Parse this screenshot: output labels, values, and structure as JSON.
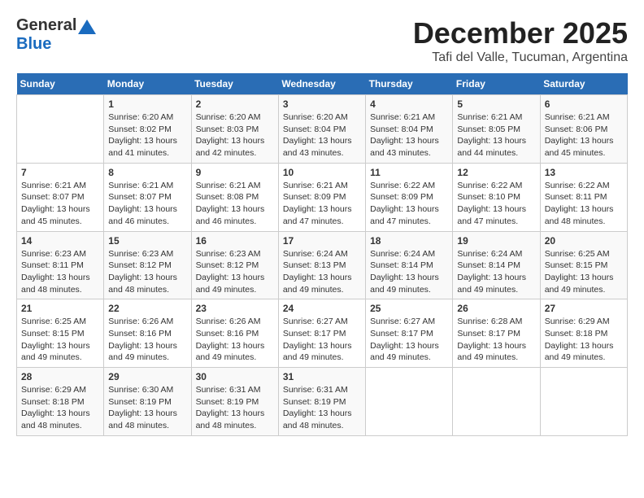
{
  "logo": {
    "general": "General",
    "blue": "Blue"
  },
  "title": "December 2025",
  "subtitle": "Tafi del Valle, Tucuman, Argentina",
  "weekdays": [
    "Sunday",
    "Monday",
    "Tuesday",
    "Wednesday",
    "Thursday",
    "Friday",
    "Saturday"
  ],
  "weeks": [
    [
      {
        "day": "",
        "content": ""
      },
      {
        "day": "1",
        "content": "Sunrise: 6:20 AM\nSunset: 8:02 PM\nDaylight: 13 hours and 41 minutes."
      },
      {
        "day": "2",
        "content": "Sunrise: 6:20 AM\nSunset: 8:03 PM\nDaylight: 13 hours and 42 minutes."
      },
      {
        "day": "3",
        "content": "Sunrise: 6:20 AM\nSunset: 8:04 PM\nDaylight: 13 hours and 43 minutes."
      },
      {
        "day": "4",
        "content": "Sunrise: 6:21 AM\nSunset: 8:04 PM\nDaylight: 13 hours and 43 minutes."
      },
      {
        "day": "5",
        "content": "Sunrise: 6:21 AM\nSunset: 8:05 PM\nDaylight: 13 hours and 44 minutes."
      },
      {
        "day": "6",
        "content": "Sunrise: 6:21 AM\nSunset: 8:06 PM\nDaylight: 13 hours and 45 minutes."
      }
    ],
    [
      {
        "day": "7",
        "content": "Sunrise: 6:21 AM\nSunset: 8:07 PM\nDaylight: 13 hours and 45 minutes."
      },
      {
        "day": "8",
        "content": "Sunrise: 6:21 AM\nSunset: 8:07 PM\nDaylight: 13 hours and 46 minutes."
      },
      {
        "day": "9",
        "content": "Sunrise: 6:21 AM\nSunset: 8:08 PM\nDaylight: 13 hours and 46 minutes."
      },
      {
        "day": "10",
        "content": "Sunrise: 6:21 AM\nSunset: 8:09 PM\nDaylight: 13 hours and 47 minutes."
      },
      {
        "day": "11",
        "content": "Sunrise: 6:22 AM\nSunset: 8:09 PM\nDaylight: 13 hours and 47 minutes."
      },
      {
        "day": "12",
        "content": "Sunrise: 6:22 AM\nSunset: 8:10 PM\nDaylight: 13 hours and 47 minutes."
      },
      {
        "day": "13",
        "content": "Sunrise: 6:22 AM\nSunset: 8:11 PM\nDaylight: 13 hours and 48 minutes."
      }
    ],
    [
      {
        "day": "14",
        "content": "Sunrise: 6:23 AM\nSunset: 8:11 PM\nDaylight: 13 hours and 48 minutes."
      },
      {
        "day": "15",
        "content": "Sunrise: 6:23 AM\nSunset: 8:12 PM\nDaylight: 13 hours and 48 minutes."
      },
      {
        "day": "16",
        "content": "Sunrise: 6:23 AM\nSunset: 8:12 PM\nDaylight: 13 hours and 49 minutes."
      },
      {
        "day": "17",
        "content": "Sunrise: 6:24 AM\nSunset: 8:13 PM\nDaylight: 13 hours and 49 minutes."
      },
      {
        "day": "18",
        "content": "Sunrise: 6:24 AM\nSunset: 8:14 PM\nDaylight: 13 hours and 49 minutes."
      },
      {
        "day": "19",
        "content": "Sunrise: 6:24 AM\nSunset: 8:14 PM\nDaylight: 13 hours and 49 minutes."
      },
      {
        "day": "20",
        "content": "Sunrise: 6:25 AM\nSunset: 8:15 PM\nDaylight: 13 hours and 49 minutes."
      }
    ],
    [
      {
        "day": "21",
        "content": "Sunrise: 6:25 AM\nSunset: 8:15 PM\nDaylight: 13 hours and 49 minutes."
      },
      {
        "day": "22",
        "content": "Sunrise: 6:26 AM\nSunset: 8:16 PM\nDaylight: 13 hours and 49 minutes."
      },
      {
        "day": "23",
        "content": "Sunrise: 6:26 AM\nSunset: 8:16 PM\nDaylight: 13 hours and 49 minutes."
      },
      {
        "day": "24",
        "content": "Sunrise: 6:27 AM\nSunset: 8:17 PM\nDaylight: 13 hours and 49 minutes."
      },
      {
        "day": "25",
        "content": "Sunrise: 6:27 AM\nSunset: 8:17 PM\nDaylight: 13 hours and 49 minutes."
      },
      {
        "day": "26",
        "content": "Sunrise: 6:28 AM\nSunset: 8:17 PM\nDaylight: 13 hours and 49 minutes."
      },
      {
        "day": "27",
        "content": "Sunrise: 6:29 AM\nSunset: 8:18 PM\nDaylight: 13 hours and 49 minutes."
      }
    ],
    [
      {
        "day": "28",
        "content": "Sunrise: 6:29 AM\nSunset: 8:18 PM\nDaylight: 13 hours and 48 minutes."
      },
      {
        "day": "29",
        "content": "Sunrise: 6:30 AM\nSunset: 8:19 PM\nDaylight: 13 hours and 48 minutes."
      },
      {
        "day": "30",
        "content": "Sunrise: 6:31 AM\nSunset: 8:19 PM\nDaylight: 13 hours and 48 minutes."
      },
      {
        "day": "31",
        "content": "Sunrise: 6:31 AM\nSunset: 8:19 PM\nDaylight: 13 hours and 48 minutes."
      },
      {
        "day": "",
        "content": ""
      },
      {
        "day": "",
        "content": ""
      },
      {
        "day": "",
        "content": ""
      }
    ]
  ]
}
